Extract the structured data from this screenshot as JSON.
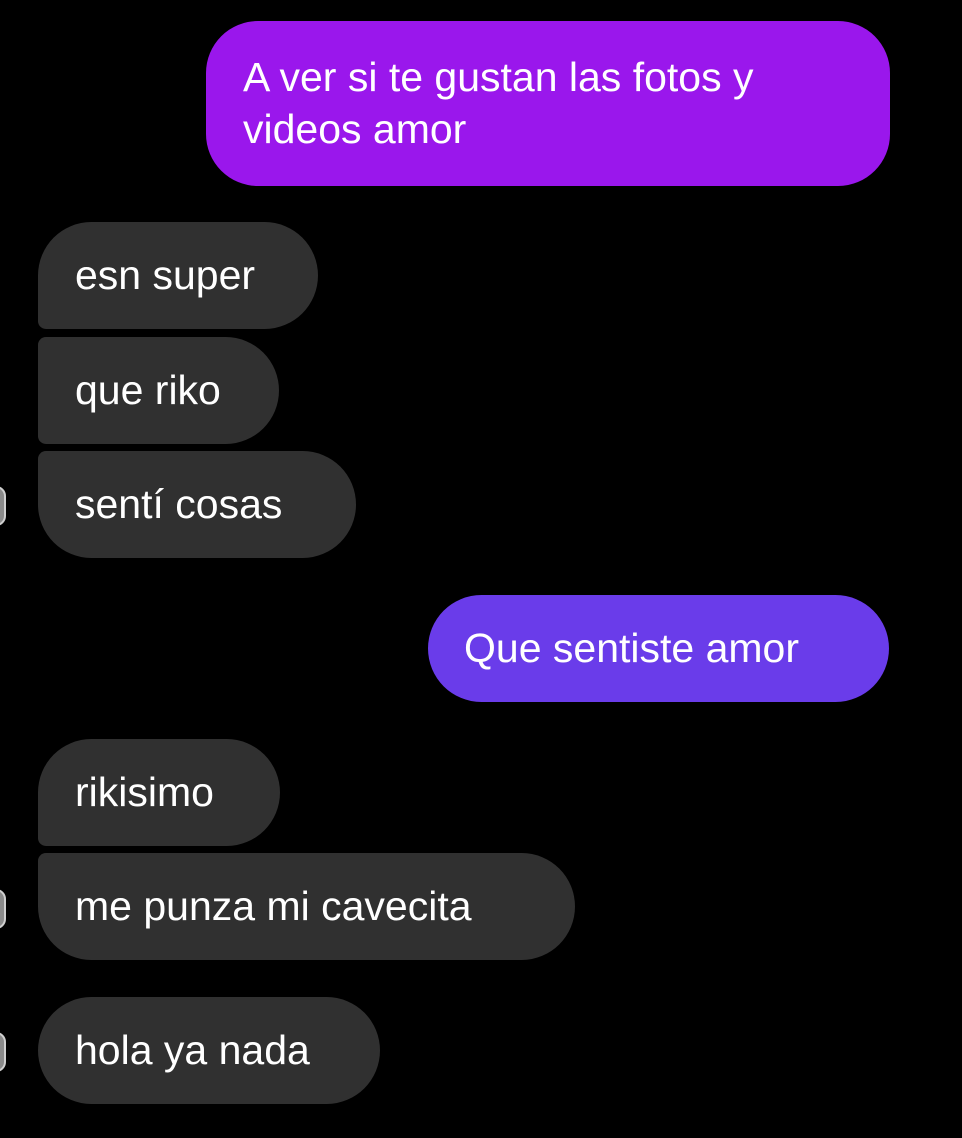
{
  "messages": [
    {
      "id": "b1",
      "direction": "outgoing",
      "text": "A ver si te gustan las fotos y videos amor"
    },
    {
      "id": "b2",
      "direction": "incoming",
      "text": "esn super"
    },
    {
      "id": "b3",
      "direction": "incoming",
      "text": "que riko"
    },
    {
      "id": "b4",
      "direction": "incoming",
      "text": "sentí cosas"
    },
    {
      "id": "b5",
      "direction": "outgoing",
      "text": "Que sentiste amor"
    },
    {
      "id": "b6",
      "direction": "incoming",
      "text": "rikisimo"
    },
    {
      "id": "b7",
      "direction": "incoming",
      "text": "me punza mi cavecita"
    },
    {
      "id": "b8",
      "direction": "incoming",
      "text": "hola ya nada"
    }
  ],
  "colors": {
    "background": "#000000",
    "incoming_bubble": "#303030",
    "outgoing_bubble_1": "#9a17ec",
    "outgoing_bubble_2": "#6a3cea",
    "text": "#ffffff"
  }
}
